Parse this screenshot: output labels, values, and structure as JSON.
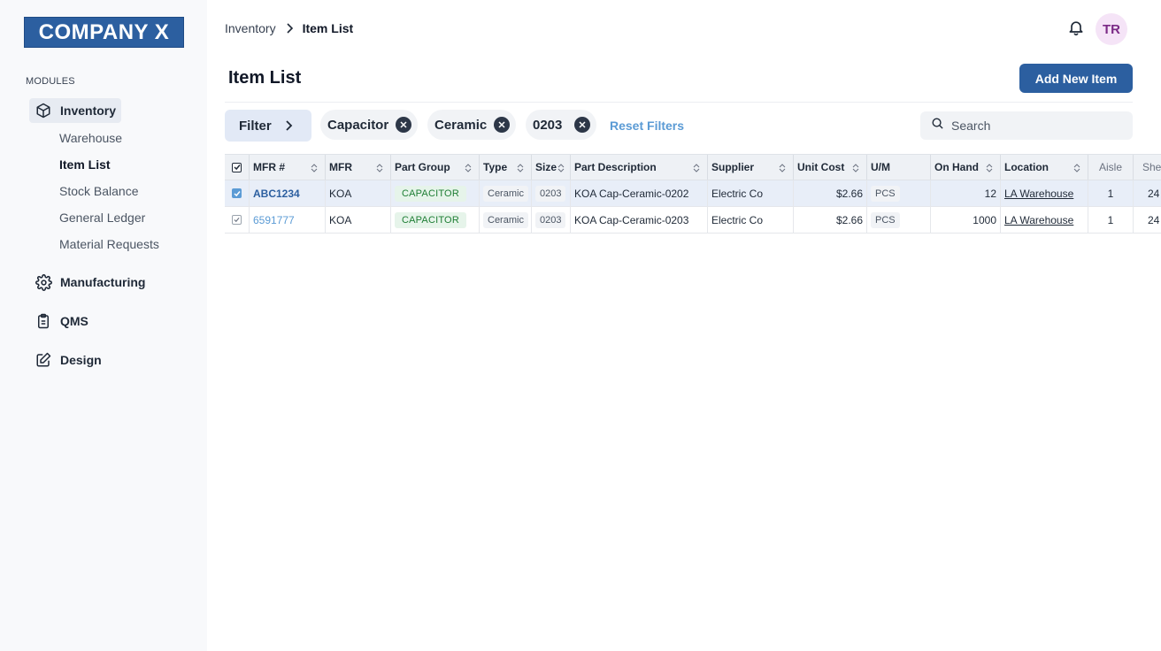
{
  "sidebar": {
    "logo": "COMPANY X",
    "modules_label": "MODULES",
    "inventory": {
      "label": "Inventory",
      "icon": "box-icon",
      "sub_items": [
        {
          "label": "Warehouse"
        },
        {
          "label": "Item List"
        },
        {
          "label": "Stock Balance"
        },
        {
          "label": "General Ledger"
        },
        {
          "label": "Material Requests"
        }
      ]
    },
    "modules": [
      {
        "label": "Manufacturing",
        "icon": "gear-icon"
      },
      {
        "label": "QMS",
        "icon": "clipboard-icon"
      },
      {
        "label": "Design",
        "icon": "edit-icon"
      }
    ]
  },
  "header": {
    "breadcrumb": [
      "Inventory",
      "Item List"
    ],
    "avatar": "TR"
  },
  "page": {
    "title": "Item List",
    "add_button": "Add New Item"
  },
  "filters": {
    "filter_label": "Filter",
    "chips": [
      "Capacitor",
      "Ceramic",
      "0203"
    ],
    "reset_label": "Reset Filters",
    "search_placeholder": "Search"
  },
  "table": {
    "columns": [
      "MFR #",
      "MFR",
      "Part Group",
      "Type",
      "Size",
      "Part Description",
      "Supplier",
      "Unit Cost",
      "U/M",
      "On Hand",
      "Location",
      "Aisle",
      "Shelf"
    ],
    "rows": [
      {
        "selected": true,
        "mfr_no": "ABC1234",
        "mfr": "KOA",
        "part_group": "CAPACITOR",
        "type": "Ceramic",
        "size": "0203",
        "description": "KOA Cap-Ceramic-0202",
        "supplier": "Electric Co",
        "unit_cost": "$2.66",
        "um": "PCS",
        "on_hand": "12",
        "location": "LA Warehouse",
        "aisle": "1",
        "shelf": "24"
      },
      {
        "selected": false,
        "mfr_no": "6591777",
        "mfr": "KOA",
        "part_group": "CAPACITOR",
        "type": "Ceramic",
        "size": "0203",
        "description": "KOA Cap-Ceramic-0203",
        "supplier": "Electric Co",
        "unit_cost": "$2.66",
        "um": "PCS",
        "on_hand": "1000",
        "location": "LA Warehouse",
        "aisle": "1",
        "shelf": "24"
      }
    ]
  },
  "colors": {
    "primary": "#2c5fa0",
    "link": "#5b9bd5",
    "sidebar_bg": "#f8f9fb",
    "selected_row": "#e8eef8",
    "badge_green_bg": "#e6f4ea",
    "badge_green_text": "#1e7e34"
  }
}
